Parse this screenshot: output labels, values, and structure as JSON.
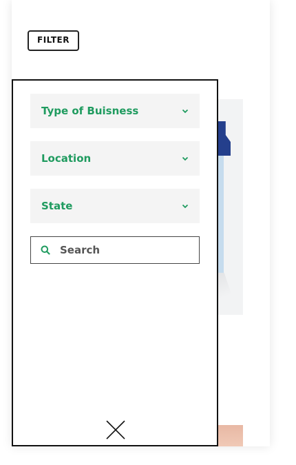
{
  "header": {
    "filter_label": "FILTER"
  },
  "filter_panel": {
    "dropdowns": [
      {
        "label": "Type of Buisness"
      },
      {
        "label": "Location"
      },
      {
        "label": "State"
      }
    ],
    "search": {
      "placeholder": "Search"
    }
  },
  "icons": {
    "chevron": "chevron-down-icon",
    "search": "search-icon",
    "close": "close-icon"
  },
  "colors": {
    "accent_green": "#1f9b5f",
    "dropdown_bg": "#f4f4f4",
    "border": "#111111"
  }
}
